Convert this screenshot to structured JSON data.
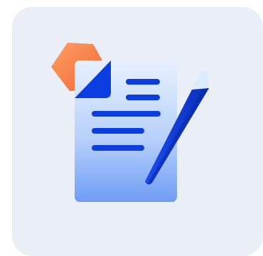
{
  "icon": {
    "name": "document-edit-icon",
    "colors": {
      "card_background": "#e9eef7",
      "page_top": "#e4f0ff",
      "page_bottom": "#6f9df5",
      "text_lines": "#0b3de0",
      "folded_corner": "#0b3de0",
      "hexagon_light": "#ff9a5c",
      "hexagon_dark": "#f06c3a",
      "pen_body": "#0b3de0",
      "pen_dark": "#0a2fb8",
      "pen_cap": "#dbeafe"
    }
  }
}
